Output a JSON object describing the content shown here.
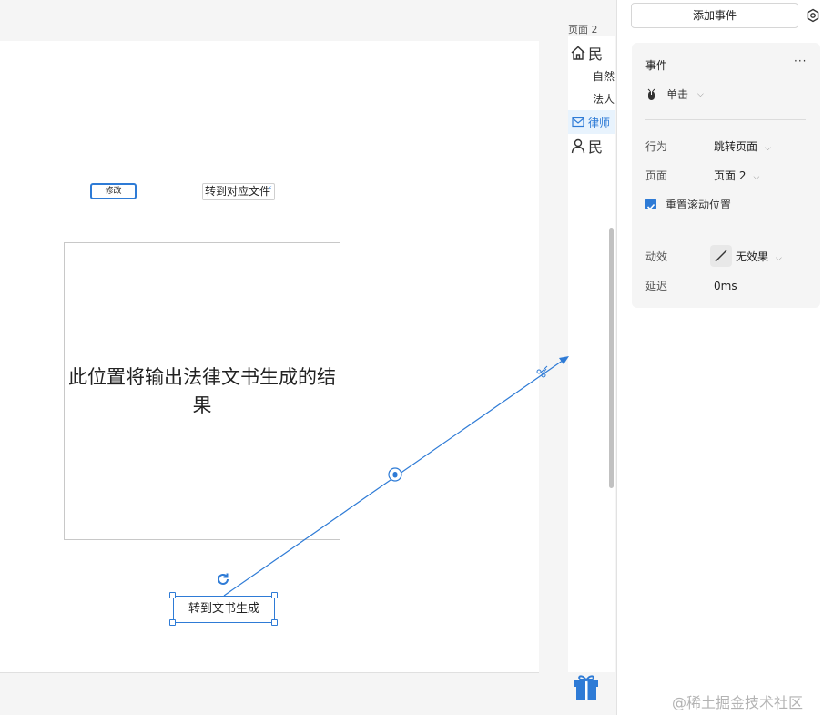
{
  "canvas": {
    "modify_button": "修改",
    "jump_doc_button": "转到对应文件",
    "output_text": "此位置将输出法律文书生成的结果",
    "generate_button": "转到文书生成"
  },
  "outline": {
    "title": "页面 2",
    "items": [
      {
        "label": "民",
        "icon": "home-icon"
      },
      {
        "label": "自然",
        "icon": ""
      },
      {
        "label": "法人",
        "icon": ""
      },
      {
        "label": "律师",
        "icon": "mail-icon"
      },
      {
        "label": "民",
        "icon": "person-icon"
      }
    ]
  },
  "right_panel": {
    "add_event": "添加事件",
    "event_title": "事件",
    "more": "···",
    "trigger": "单击",
    "action_label": "行为",
    "action_value": "跳转页面",
    "page_label": "页面",
    "page_value": "页面 2",
    "reset_scroll": "重置滚动位置",
    "effect_label": "动效",
    "effect_value": "无效果",
    "delay_label": "延迟",
    "delay_value": "0ms"
  },
  "watermark": "@稀土掘金技术社区",
  "colors": {
    "accent": "#2e7bd6",
    "panel_bg": "#f5f5f5"
  }
}
